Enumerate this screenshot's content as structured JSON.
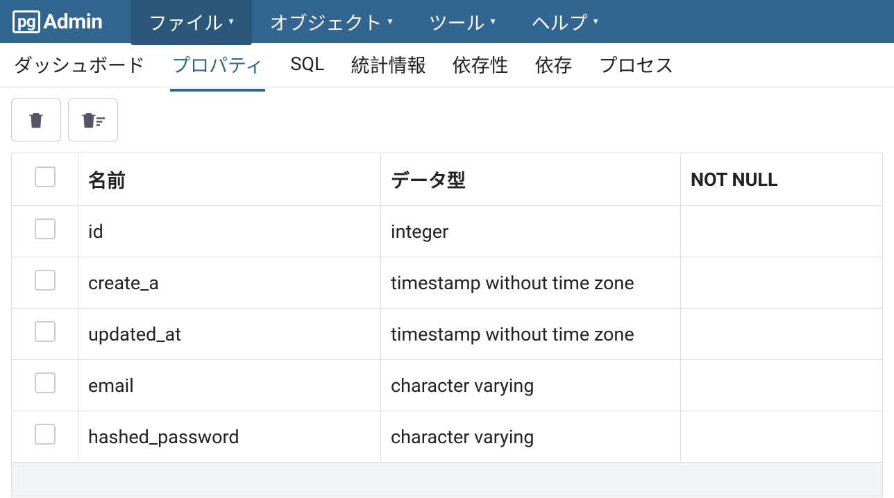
{
  "logo": {
    "boxed": "pg",
    "rest": "Admin"
  },
  "menu": [
    {
      "label": "ファイル",
      "active": true
    },
    {
      "label": "オブジェクト",
      "active": false
    },
    {
      "label": "ツール",
      "active": false
    },
    {
      "label": "ヘルプ",
      "active": false
    }
  ],
  "tabs": [
    {
      "label": "ダッシュボード",
      "active": false
    },
    {
      "label": "プロパティ",
      "active": true
    },
    {
      "label": "SQL",
      "active": false
    },
    {
      "label": "統計情報",
      "active": false
    },
    {
      "label": "依存性",
      "active": false
    },
    {
      "label": "依存",
      "active": false
    },
    {
      "label": "プロセス",
      "active": false
    }
  ],
  "table": {
    "headers": {
      "name": "名前",
      "datatype": "データ型",
      "notnull": "NOT NULL"
    },
    "rows": [
      {
        "name": "id",
        "datatype": "integer",
        "notnull": ""
      },
      {
        "name": "create_a",
        "datatype": "timestamp without time zone",
        "notnull": ""
      },
      {
        "name": "updated_at",
        "datatype": "timestamp without time zone",
        "notnull": ""
      },
      {
        "name": "email",
        "datatype": "character varying",
        "notnull": ""
      },
      {
        "name": "hashed_password",
        "datatype": "character varying",
        "notnull": ""
      }
    ]
  }
}
